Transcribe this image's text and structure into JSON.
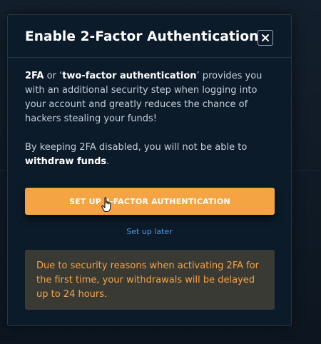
{
  "modal": {
    "title": "Enable 2-Factor Authentication",
    "close_label": "×",
    "paragraph1": {
      "term_short": "2FA",
      "or": " or ‘",
      "term_long": "two-factor authentication",
      "rest": "’ provides you with an additional security step when logging into your account and greatly reduces the chance of hackers stealing your funds!"
    },
    "paragraph2": {
      "lead": "By keeping 2FA disabled, you will not be able to ",
      "emphasis": "withdraw funds",
      "end": "."
    },
    "primary_button_label": "SET UP 2-FACTOR AUTHENTICATION",
    "secondary_link_label": "Set up later",
    "warning_text": "Due to security reasons when activating 2FA for the first time, your withdrawals will be delayed up to 24 hours."
  },
  "colors": {
    "accent": "#f4a442",
    "link": "#4a9ae0",
    "modal_bg": "#0c1b2a",
    "warning_bg": "#3a3a35"
  }
}
